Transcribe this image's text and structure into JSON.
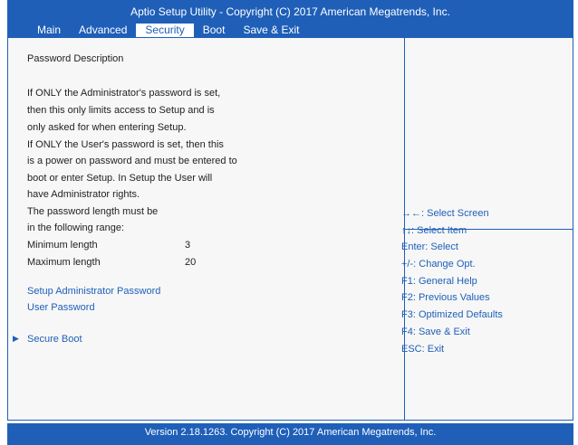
{
  "header": {
    "title": "Aptio Setup Utility - Copyright  (C)  2017 American Megatrends, Inc.",
    "tabs": [
      "Main",
      "Advanced",
      "Security",
      "Boot",
      "Save & Exit"
    ],
    "active_tab": "Security"
  },
  "description": {
    "heading": "Password Description",
    "lines": [
      "If ONLY the Administrator's password is set,",
      "then this only limits access to Setup and is",
      "only asked for when entering Setup.",
      "If ONLY the User's password is set, then this",
      "is a power on password and must be entered to",
      "boot or enter Setup. In Setup the User will",
      "have Administrator rights.",
      "The password length must be",
      "in the following range:"
    ]
  },
  "settings": {
    "min_label": "Minimum length",
    "min_value": "3",
    "max_label": "Maximum length",
    "max_value": "20"
  },
  "menu": {
    "admin_password": "Setup Administrator Password",
    "user_password": "User Password",
    "secure_boot": "Secure Boot",
    "submenu_arrow": "▶"
  },
  "help": [
    "→←: Select Screen",
    "↑↓: Select Item",
    "Enter: Select",
    "+/-: Change Opt.",
    "F1: General Help",
    "F2: Previous Values",
    "F3: Optimized Defaults",
    "F4: Save & Exit",
    "ESC: Exit"
  ],
  "footer": {
    "text": "Version 2.18.1263. Copyright  (C)  2017 American Megatrends, Inc."
  },
  "colors": {
    "accent": "#1f5fb8",
    "panel_background": "#f7f7f7"
  }
}
